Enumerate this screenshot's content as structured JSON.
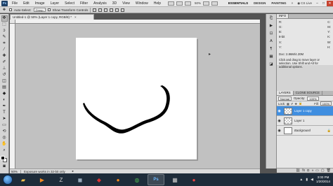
{
  "menubar": {
    "app_logo": "Ps",
    "items": [
      "File",
      "Edit",
      "Image",
      "Layer",
      "Select",
      "Filter",
      "Analysis",
      "3D",
      "View",
      "Window",
      "Help"
    ],
    "zoom": "50%",
    "workspaces": [
      "ESSENTIALS",
      "DESIGN",
      "PAINTING"
    ],
    "more": "»",
    "cs_live": "CS Live",
    "window_controls": [
      "–",
      "□",
      "✕"
    ]
  },
  "options": {
    "auto_select_label": "Auto-Select:",
    "auto_select_value": "Group",
    "show_transform_label": "Show Transform Controls"
  },
  "document": {
    "tab_title": "Untitled-1 @ 50% (Layer 1 copy, RGB/8) *",
    "close": "×"
  },
  "status": {
    "zoom": "50%",
    "message": "Exposure works in 32-bit only"
  },
  "info_panel": {
    "tabs": [
      "INFO"
    ],
    "readouts": [
      [
        "R:",
        "C:"
      ],
      [
        "G:",
        "M:"
      ],
      [
        "B:",
        "Y:"
      ],
      [
        "8-bit",
        "K:"
      ],
      [
        "X:",
        "W:"
      ],
      [
        "Y:",
        "H:"
      ]
    ],
    "doc_size": "Doc: 2.86M/4.20M",
    "tip": "Click and drag to move layer or selection. Use Shift and Alt for additional options."
  },
  "layers_panel": {
    "tabs": [
      "LAYERS",
      "CLONE SOURCE"
    ],
    "blend_mode": "Normal",
    "opacity_label": "Opacity:",
    "opacity_value": "100%",
    "lock_label": "Lock:",
    "fill_label": "Fill:",
    "fill_value": "100%",
    "layers": [
      {
        "name": "Layer 1 copy",
        "selected": true
      },
      {
        "name": "Layer 1",
        "selected": false
      },
      {
        "name": "Background",
        "selected": false
      }
    ]
  },
  "taskbar": {
    "time": "3:00 PM",
    "date": "1/20/2014"
  },
  "colors": {
    "selection": "#3f8ee0",
    "canvas": "#ffffff",
    "workspace_bg": "#c1c1c1"
  }
}
